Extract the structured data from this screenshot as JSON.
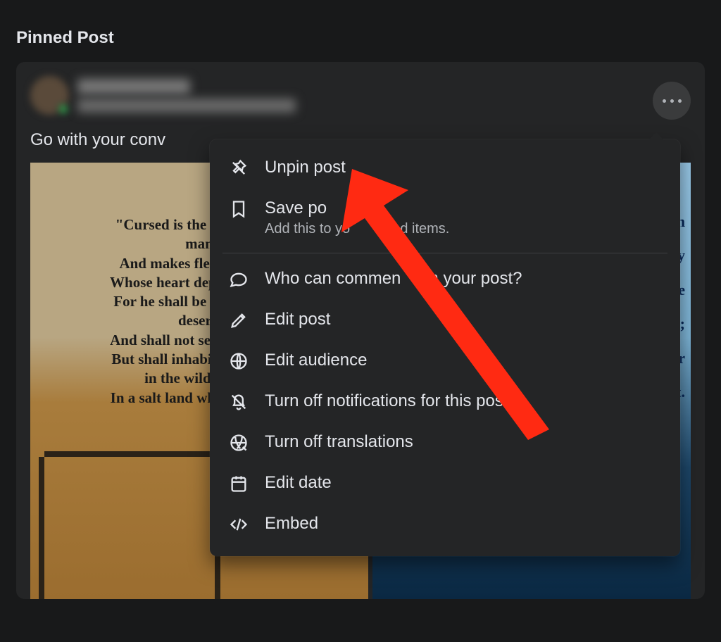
{
  "header": {
    "title": "Pinned Post"
  },
  "post": {
    "text_truncated": "Go with your conv",
    "image1_quote": "\"Cursed is the man who tr\nman\nAnd makes flesh his strer\nWhose heart departs from tl\nFor he shall be like a shrub\ndesert,\nAnd shall not see when good\nBut shall inhabit the parche\nin the wilderness,\nIn a salt land which is not in",
    "image2_fragments": [
      "in",
      "d by",
      "he",
      "ies;",
      "ear",
      "it."
    ]
  },
  "menu": {
    "items": [
      {
        "label": "Unpin post",
        "sub": ""
      },
      {
        "label": "Save po",
        "sub": "Add this to yo       aved items."
      },
      {
        "divider": true
      },
      {
        "label": "Who can commen    on your post?"
      },
      {
        "label": "Edit post"
      },
      {
        "label": "Edit audience"
      },
      {
        "label": "Turn off notifications for this post"
      },
      {
        "label": "Turn off translations"
      },
      {
        "label": "Edit date"
      },
      {
        "label": "Embed"
      }
    ]
  }
}
